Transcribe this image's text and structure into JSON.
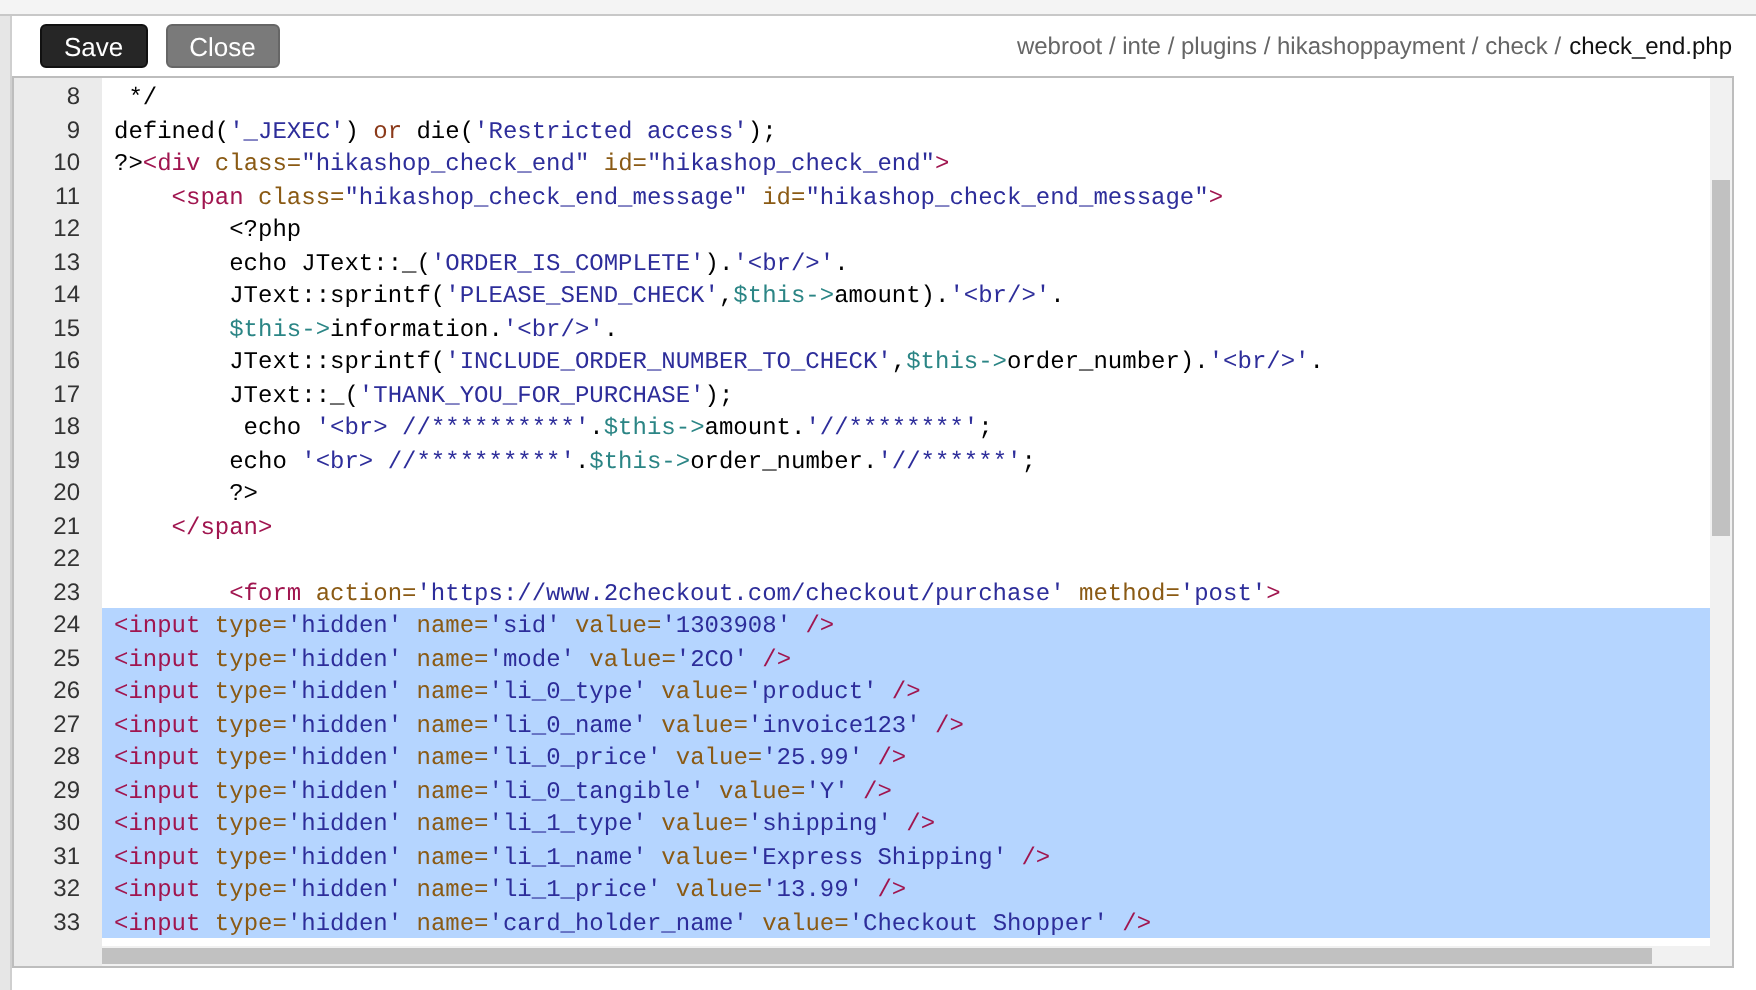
{
  "toolbar": {
    "buttons": [
      {
        "label": "Save",
        "kind": "primary"
      },
      {
        "label": "Close",
        "kind": "secondary"
      }
    ],
    "breadcrumb": {
      "path": "webroot / inte / plugins / hikashoppayment / check /",
      "file": "check_end.php"
    }
  },
  "editor": {
    "lines": [
      {
        "number": "8",
        "selected": false,
        "tokens": [
          {
            "kind": "plain",
            "text": " */"
          }
        ]
      },
      {
        "number": "9",
        "selected": false,
        "tokens": [
          {
            "kind": "plain",
            "text": "defined("
          },
          {
            "kind": "string",
            "text": "'_JEXEC'"
          },
          {
            "kind": "plain",
            "text": ") "
          },
          {
            "kind": "keyword",
            "text": "or"
          },
          {
            "kind": "plain",
            "text": " die("
          },
          {
            "kind": "string",
            "text": "'Restricted access'"
          },
          {
            "kind": "plain",
            "text": ");"
          }
        ]
      },
      {
        "number": "10",
        "selected": false,
        "tokens": [
          {
            "kind": "plain",
            "text": "?>"
          },
          {
            "kind": "tag",
            "text": "<div"
          },
          {
            "kind": "attr",
            "text": " class="
          },
          {
            "kind": "string",
            "text": "\"hikashop_check_end\""
          },
          {
            "kind": "attr",
            "text": " id="
          },
          {
            "kind": "string",
            "text": "\"hikashop_check_end\""
          },
          {
            "kind": "tag",
            "text": ">"
          }
        ]
      },
      {
        "number": "11",
        "selected": false,
        "tokens": [
          {
            "kind": "tag",
            "text": "    <span"
          },
          {
            "kind": "attr",
            "text": " class="
          },
          {
            "kind": "string",
            "text": "\"hikashop_check_end_message\""
          },
          {
            "kind": "attr",
            "text": " id="
          },
          {
            "kind": "string",
            "text": "\"hikashop_check_end_message\""
          },
          {
            "kind": "tag",
            "text": ">"
          }
        ]
      },
      {
        "number": "12",
        "selected": false,
        "tokens": [
          {
            "kind": "plain",
            "text": "        <?php"
          }
        ]
      },
      {
        "number": "13",
        "selected": false,
        "tokens": [
          {
            "kind": "plain",
            "text": "        echo JText::_("
          },
          {
            "kind": "string",
            "text": "'ORDER_IS_COMPLETE'"
          },
          {
            "kind": "plain",
            "text": ")."
          },
          {
            "kind": "string",
            "text": "'<br/>'"
          },
          {
            "kind": "plain",
            "text": "."
          }
        ]
      },
      {
        "number": "14",
        "selected": false,
        "tokens": [
          {
            "kind": "plain",
            "text": "        JText::sprintf("
          },
          {
            "kind": "string",
            "text": "'PLEASE_SEND_CHECK'"
          },
          {
            "kind": "plain",
            "text": ","
          },
          {
            "kind": "variable",
            "text": "$this->"
          },
          {
            "kind": "plain",
            "text": "amount)."
          },
          {
            "kind": "string",
            "text": "'<br/>'"
          },
          {
            "kind": "plain",
            "text": "."
          }
        ]
      },
      {
        "number": "15",
        "selected": false,
        "tokens": [
          {
            "kind": "variable",
            "text": "        $this->"
          },
          {
            "kind": "plain",
            "text": "information."
          },
          {
            "kind": "string",
            "text": "'<br/>'"
          },
          {
            "kind": "plain",
            "text": "."
          }
        ]
      },
      {
        "number": "16",
        "selected": false,
        "tokens": [
          {
            "kind": "plain",
            "text": "        JText::sprintf("
          },
          {
            "kind": "string",
            "text": "'INCLUDE_ORDER_NUMBER_TO_CHECK'"
          },
          {
            "kind": "plain",
            "text": ","
          },
          {
            "kind": "variable",
            "text": "$this->"
          },
          {
            "kind": "plain",
            "text": "order_number)."
          },
          {
            "kind": "string",
            "text": "'<br/>'"
          },
          {
            "kind": "plain",
            "text": "."
          }
        ]
      },
      {
        "number": "17",
        "selected": false,
        "tokens": [
          {
            "kind": "plain",
            "text": "        JText::_("
          },
          {
            "kind": "string",
            "text": "'THANK_YOU_FOR_PURCHASE'"
          },
          {
            "kind": "plain",
            "text": ");"
          }
        ]
      },
      {
        "number": "18",
        "selected": false,
        "tokens": [
          {
            "kind": "plain",
            "text": "         echo "
          },
          {
            "kind": "string",
            "text": "'<br> //**********'"
          },
          {
            "kind": "plain",
            "text": "."
          },
          {
            "kind": "variable",
            "text": "$this->"
          },
          {
            "kind": "plain",
            "text": "amount."
          },
          {
            "kind": "string",
            "text": "'//********'"
          },
          {
            "kind": "plain",
            "text": ";"
          }
        ]
      },
      {
        "number": "19",
        "selected": false,
        "tokens": [
          {
            "kind": "plain",
            "text": "        echo "
          },
          {
            "kind": "string",
            "text": "'<br> //**********'"
          },
          {
            "kind": "plain",
            "text": "."
          },
          {
            "kind": "variable",
            "text": "$this->"
          },
          {
            "kind": "plain",
            "text": "order_number."
          },
          {
            "kind": "string",
            "text": "'//******'"
          },
          {
            "kind": "plain",
            "text": ";"
          }
        ]
      },
      {
        "number": "20",
        "selected": false,
        "tokens": [
          {
            "kind": "plain",
            "text": "        ?>"
          }
        ]
      },
      {
        "number": "21",
        "selected": false,
        "tokens": [
          {
            "kind": "tag",
            "text": "    </span>"
          }
        ]
      },
      {
        "number": "22",
        "selected": false
      },
      {
        "number": "23",
        "selected": false,
        "tokens": [
          {
            "kind": "tag",
            "text": "        <form"
          },
          {
            "kind": "attr",
            "text": " action="
          },
          {
            "kind": "string",
            "text": "'https://www.2checkout.com/checkout/purchase'"
          },
          {
            "kind": "attr",
            "text": " method="
          },
          {
            "kind": "string",
            "text": "'post'"
          },
          {
            "kind": "tag",
            "text": ">"
          }
        ]
      },
      {
        "number": "24",
        "selected": true,
        "tokens": [
          {
            "kind": "tag",
            "text": "<input"
          },
          {
            "kind": "attr",
            "text": " type="
          },
          {
            "kind": "string",
            "text": "'hidden'"
          },
          {
            "kind": "attr",
            "text": " name="
          },
          {
            "kind": "string",
            "text": "'sid'"
          },
          {
            "kind": "attr",
            "text": " value="
          },
          {
            "kind": "string",
            "text": "'1303908'"
          },
          {
            "kind": "tag",
            "text": " />"
          }
        ]
      },
      {
        "number": "25",
        "selected": true,
        "tokens": [
          {
            "kind": "tag",
            "text": "<input"
          },
          {
            "kind": "attr",
            "text": " type="
          },
          {
            "kind": "string",
            "text": "'hidden'"
          },
          {
            "kind": "attr",
            "text": " name="
          },
          {
            "kind": "string",
            "text": "'mode'"
          },
          {
            "kind": "attr",
            "text": " value="
          },
          {
            "kind": "string",
            "text": "'2CO'"
          },
          {
            "kind": "tag",
            "text": " />"
          }
        ]
      },
      {
        "number": "26",
        "selected": true,
        "tokens": [
          {
            "kind": "tag",
            "text": "<input"
          },
          {
            "kind": "attr",
            "text": " type="
          },
          {
            "kind": "string",
            "text": "'hidden'"
          },
          {
            "kind": "attr",
            "text": " name="
          },
          {
            "kind": "string",
            "text": "'li_0_type'"
          },
          {
            "kind": "attr",
            "text": " value="
          },
          {
            "kind": "string",
            "text": "'product'"
          },
          {
            "kind": "tag",
            "text": " />"
          }
        ]
      },
      {
        "number": "27",
        "selected": true,
        "tokens": [
          {
            "kind": "tag",
            "text": "<input"
          },
          {
            "kind": "attr",
            "text": " type="
          },
          {
            "kind": "string",
            "text": "'hidden'"
          },
          {
            "kind": "attr",
            "text": " name="
          },
          {
            "kind": "string",
            "text": "'li_0_name'"
          },
          {
            "kind": "attr",
            "text": " value="
          },
          {
            "kind": "string",
            "text": "'invoice123'"
          },
          {
            "kind": "tag",
            "text": " />"
          }
        ]
      },
      {
        "number": "28",
        "selected": true,
        "tokens": [
          {
            "kind": "tag",
            "text": "<input"
          },
          {
            "kind": "attr",
            "text": " type="
          },
          {
            "kind": "string",
            "text": "'hidden'"
          },
          {
            "kind": "attr",
            "text": " name="
          },
          {
            "kind": "string",
            "text": "'li_0_price'"
          },
          {
            "kind": "attr",
            "text": " value="
          },
          {
            "kind": "string",
            "text": "'25.99'"
          },
          {
            "kind": "tag",
            "text": " />"
          }
        ]
      },
      {
        "number": "29",
        "selected": true,
        "tokens": [
          {
            "kind": "tag",
            "text": "<input"
          },
          {
            "kind": "attr",
            "text": " type="
          },
          {
            "kind": "string",
            "text": "'hidden'"
          },
          {
            "kind": "attr",
            "text": " name="
          },
          {
            "kind": "string",
            "text": "'li_0_tangible'"
          },
          {
            "kind": "attr",
            "text": " value="
          },
          {
            "kind": "string",
            "text": "'Y'"
          },
          {
            "kind": "tag",
            "text": " />"
          }
        ]
      },
      {
        "number": "30",
        "selected": true,
        "tokens": [
          {
            "kind": "tag",
            "text": "<input"
          },
          {
            "kind": "attr",
            "text": " type="
          },
          {
            "kind": "string",
            "text": "'hidden'"
          },
          {
            "kind": "attr",
            "text": " name="
          },
          {
            "kind": "string",
            "text": "'li_1_type'"
          },
          {
            "kind": "attr",
            "text": " value="
          },
          {
            "kind": "string",
            "text": "'shipping'"
          },
          {
            "kind": "tag",
            "text": " />"
          }
        ]
      },
      {
        "number": "31",
        "selected": true,
        "tokens": [
          {
            "kind": "tag",
            "text": "<input"
          },
          {
            "kind": "attr",
            "text": " type="
          },
          {
            "kind": "string",
            "text": "'hidden'"
          },
          {
            "kind": "attr",
            "text": " name="
          },
          {
            "kind": "string",
            "text": "'li_1_name'"
          },
          {
            "kind": "attr",
            "text": " value="
          },
          {
            "kind": "string",
            "text": "'Express Shipping'"
          },
          {
            "kind": "tag",
            "text": " />"
          }
        ]
      },
      {
        "number": "32",
        "selected": true,
        "tokens": [
          {
            "kind": "tag",
            "text": "<input"
          },
          {
            "kind": "attr",
            "text": " type="
          },
          {
            "kind": "string",
            "text": "'hidden'"
          },
          {
            "kind": "attr",
            "text": " name="
          },
          {
            "kind": "string",
            "text": "'li_1_price'"
          },
          {
            "kind": "attr",
            "text": " value="
          },
          {
            "kind": "string",
            "text": "'13.99'"
          },
          {
            "kind": "tag",
            "text": " />"
          }
        ]
      },
      {
        "number": "33",
        "selected": true,
        "tokens": [
          {
            "kind": "tag",
            "text": "<input"
          },
          {
            "kind": "attr",
            "text": " type="
          },
          {
            "kind": "string",
            "text": "'hidden'"
          },
          {
            "kind": "attr",
            "text": " name="
          },
          {
            "kind": "string",
            "text": "'card_holder_name'"
          },
          {
            "kind": "attr",
            "text": " value="
          },
          {
            "kind": "string",
            "text": "'Checkout Shopper'"
          },
          {
            "kind": "tag",
            "text": " />"
          }
        ]
      }
    ]
  }
}
